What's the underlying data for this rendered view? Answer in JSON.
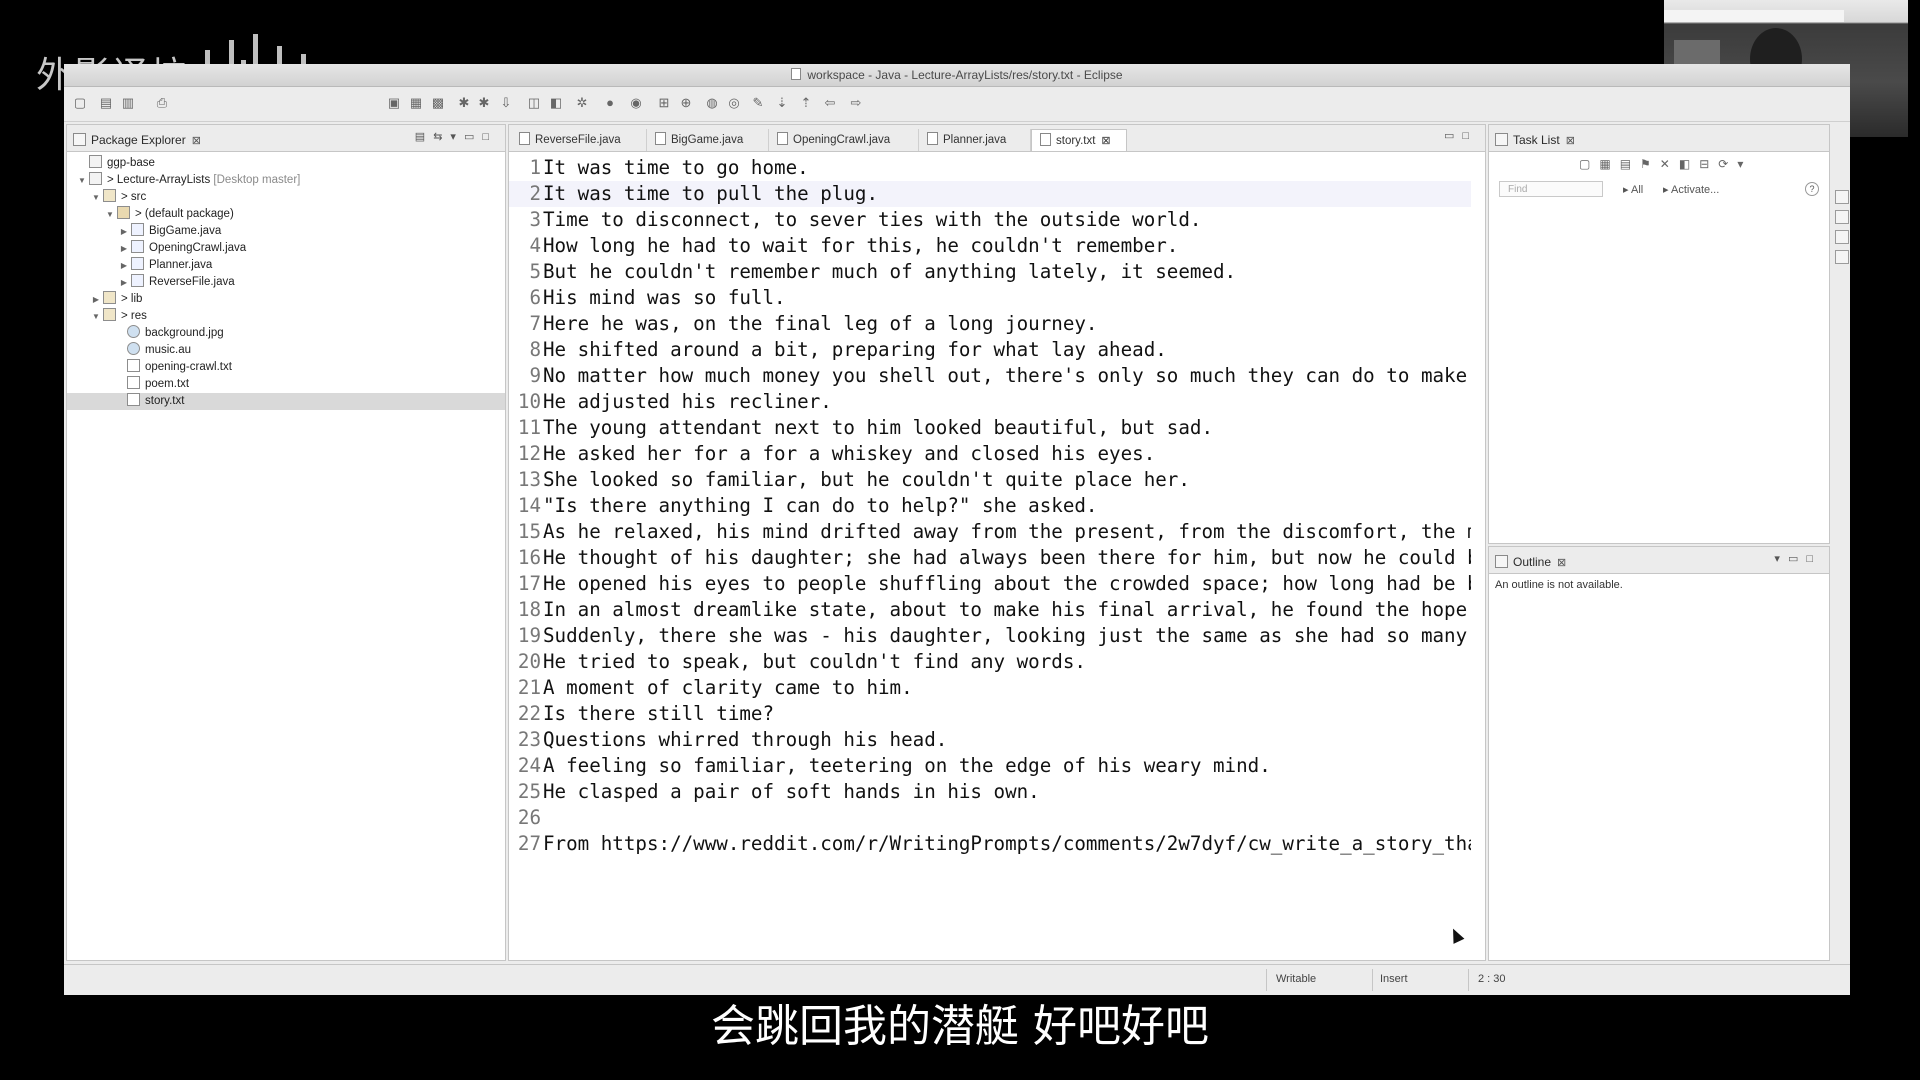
{
  "watermark": {
    "text": "外影译坊"
  },
  "window": {
    "title": "workspace - Java - Lecture-ArrayLists/res/story.txt - Eclipse"
  },
  "package_explorer": {
    "title": "Package Explorer",
    "tree": [
      {
        "label": "ggp-base",
        "extra": "",
        "twisty": "",
        "icon": "project"
      },
      {
        "label": "> Lecture-ArrayLists",
        "extra": " [Desktop master]",
        "twisty": "▼",
        "icon": "project"
      },
      {
        "label": "> src",
        "extra": "",
        "twisty": "▼",
        "icon": "folder"
      },
      {
        "label": "> (default package)",
        "extra": "",
        "twisty": "▼",
        "icon": "pkg"
      },
      {
        "label": "BigGame.java",
        "extra": "",
        "twisty": "▶",
        "icon": "java"
      },
      {
        "label": "OpeningCrawl.java",
        "extra": "",
        "twisty": "▶",
        "icon": "java"
      },
      {
        "label": "Planner.java",
        "extra": "",
        "twisty": "▶",
        "icon": "java"
      },
      {
        "label": "ReverseFile.java",
        "extra": "",
        "twisty": "▶",
        "icon": "java"
      },
      {
        "label": "> lib",
        "extra": "",
        "twisty": "▶",
        "icon": "folder"
      },
      {
        "label": "> res",
        "extra": "",
        "twisty": "▼",
        "icon": "folder"
      },
      {
        "label": "background.jpg",
        "extra": "",
        "twisty": "",
        "icon": "img"
      },
      {
        "label": "music.au",
        "extra": "",
        "twisty": "",
        "icon": "img"
      },
      {
        "label": "opening-crawl.txt",
        "extra": "",
        "twisty": "",
        "icon": "file"
      },
      {
        "label": "poem.txt",
        "extra": "",
        "twisty": "",
        "icon": "file"
      },
      {
        "label": "story.txt",
        "extra": "",
        "twisty": "",
        "icon": "file"
      }
    ]
  },
  "editor": {
    "tabs": [
      {
        "label": "ReverseFile.java"
      },
      {
        "label": "BigGame.java"
      },
      {
        "label": "OpeningCrawl.java"
      },
      {
        "label": "Planner.java"
      },
      {
        "label": "story.txt"
      }
    ],
    "lines": [
      {
        "n": "1",
        "text": "It was time to go home."
      },
      {
        "n": "2",
        "text": "It was time to pull the plug."
      },
      {
        "n": "3",
        "text": "Time to disconnect, to sever ties with the outside world."
      },
      {
        "n": "4",
        "text": "How long he had to wait for this, he couldn't remember."
      },
      {
        "n": "5",
        "text": "But he couldn't remember much of anything lately, it seemed."
      },
      {
        "n": "6",
        "text": "His mind was so full."
      },
      {
        "n": "7",
        "text": "Here he was, on the final leg of a long journey."
      },
      {
        "n": "8",
        "text": "He shifted around a bit, preparing for what lay ahead."
      },
      {
        "n": "9",
        "text": "No matter how much money you shell out, there's only so much they can do to make"
      },
      {
        "n": "10",
        "text": "He adjusted his recliner."
      },
      {
        "n": "11",
        "text": "The young attendant next to him looked beautiful, but sad."
      },
      {
        "n": "12",
        "text": "He asked her for a for a whiskey and closed his eyes."
      },
      {
        "n": "13",
        "text": "She looked so familiar, but he couldn't quite place her."
      },
      {
        "n": "14",
        "text": "\"Is there anything I can do to help?\" she asked."
      },
      {
        "n": "15",
        "text": "As he relaxed, his mind drifted away from the present, from the discomfort, the m"
      },
      {
        "n": "16",
        "text": "He thought of his daughter; she had always been there for him, but now he could b"
      },
      {
        "n": "17",
        "text": "He opened his eyes to people shuffling about the crowded space; how long had be b"
      },
      {
        "n": "18",
        "text": "In an almost dreamlike state, about to make his final arrival, he found the hope"
      },
      {
        "n": "19",
        "text": "Suddenly, there she was - his daughter, looking just the same as she had so many"
      },
      {
        "n": "20",
        "text": "He tried to speak, but couldn't find any words."
      },
      {
        "n": "21",
        "text": "A moment of clarity came to him."
      },
      {
        "n": "22",
        "text": "Is there still time?"
      },
      {
        "n": "23",
        "text": "Questions whirred through his head."
      },
      {
        "n": "24",
        "text": "A feeling so familiar, teetering on the edge of his weary mind."
      },
      {
        "n": "25",
        "text": "He clasped a pair of soft hands in his own."
      },
      {
        "n": "26",
        "text": ""
      },
      {
        "n": "27",
        "text": "From https://www.reddit.com/r/WritingPrompts/comments/2w7dyf/cw_write_a_story_tha"
      }
    ]
  },
  "task_list": {
    "title": "Task List",
    "find_placeholder": "Find",
    "all_label": "All",
    "activate_label": "Activate..."
  },
  "outline": {
    "title": "Outline",
    "message": "An outline is not available."
  },
  "status_bar": {
    "writable": "Writable",
    "insert_mode": "Insert",
    "position": "2 : 30"
  },
  "subtitle": {
    "text": "会跳回我的潜艇 好吧好吧"
  },
  "colors": {
    "selection": "#d9d9d9",
    "current_line": "#f3f3fb"
  }
}
